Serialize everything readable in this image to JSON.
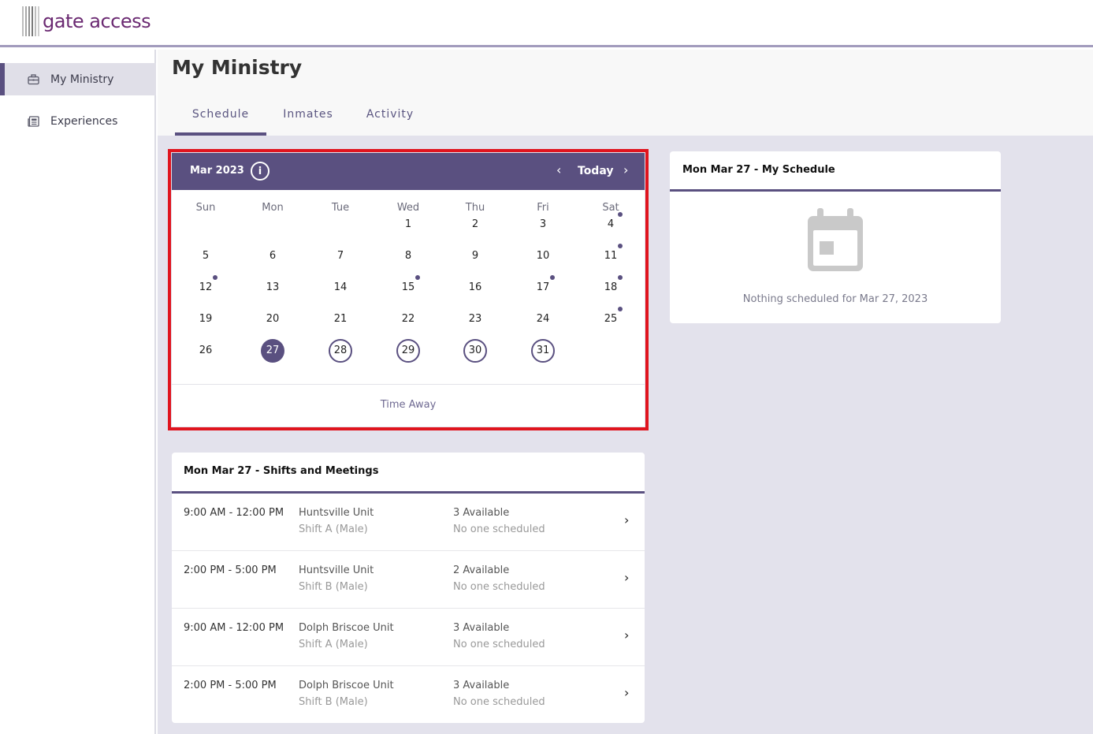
{
  "app": {
    "logo_text": "gate access"
  },
  "sidebar": {
    "items": [
      {
        "label": "My Ministry",
        "icon": "briefcase-icon",
        "active": true
      },
      {
        "label": "Experiences",
        "icon": "newspaper-icon",
        "active": false
      }
    ]
  },
  "header": {
    "title": "My Ministry",
    "tabs": [
      {
        "label": "Schedule",
        "active": true
      },
      {
        "label": "Inmates",
        "active": false
      },
      {
        "label": "Activity",
        "active": false
      }
    ]
  },
  "calendar": {
    "month_label": "Mar 2023",
    "info_glyph": "i",
    "prev_glyph": "‹",
    "today_label": "Today",
    "next_glyph": "›",
    "weekdays": [
      "Sun",
      "Mon",
      "Tue",
      "Wed",
      "Thu",
      "Fri",
      "Sat"
    ],
    "weeks": [
      [
        "",
        "",
        "",
        "1",
        "2",
        "3",
        "4"
      ],
      [
        "5",
        "6",
        "7",
        "8",
        "9",
        "10",
        "11"
      ],
      [
        "12",
        "13",
        "14",
        "15",
        "16",
        "17",
        "18"
      ],
      [
        "19",
        "20",
        "21",
        "22",
        "23",
        "24",
        "25"
      ],
      [
        "26",
        "27",
        "28",
        "29",
        "30",
        "31",
        ""
      ]
    ],
    "selected_day": "27",
    "upcoming_days": [
      "28",
      "29",
      "30",
      "31"
    ],
    "event_days": [
      "4",
      "11",
      "12",
      "15",
      "17",
      "18",
      "25"
    ],
    "footer_link": "Time Away",
    "accent_color": "#5a5080"
  },
  "my_schedule": {
    "title": "Mon Mar 27 - My Schedule",
    "icon": "calendar-icon",
    "empty_text": "Nothing scheduled for Mar 27, 2023"
  },
  "shifts": {
    "title": "Mon Mar 27 - Shifts and Meetings",
    "chevron_glyph": "›",
    "rows": [
      {
        "time": "9:00 AM - 12:00 PM",
        "unit": "Huntsville Unit",
        "shift": "Shift A (Male)",
        "available": "3 Available",
        "scheduled": "No one scheduled"
      },
      {
        "time": "2:00 PM - 5:00 PM",
        "unit": "Huntsville Unit",
        "shift": "Shift B (Male)",
        "available": "2 Available",
        "scheduled": "No one scheduled"
      },
      {
        "time": "9:00 AM - 12:00 PM",
        "unit": "Dolph Briscoe Unit",
        "shift": "Shift A (Male)",
        "available": "3 Available",
        "scheduled": "No one scheduled"
      },
      {
        "time": "2:00 PM - 5:00 PM",
        "unit": "Dolph Briscoe Unit",
        "shift": "Shift B (Male)",
        "available": "3 Available",
        "scheduled": "No one scheduled"
      }
    ]
  }
}
